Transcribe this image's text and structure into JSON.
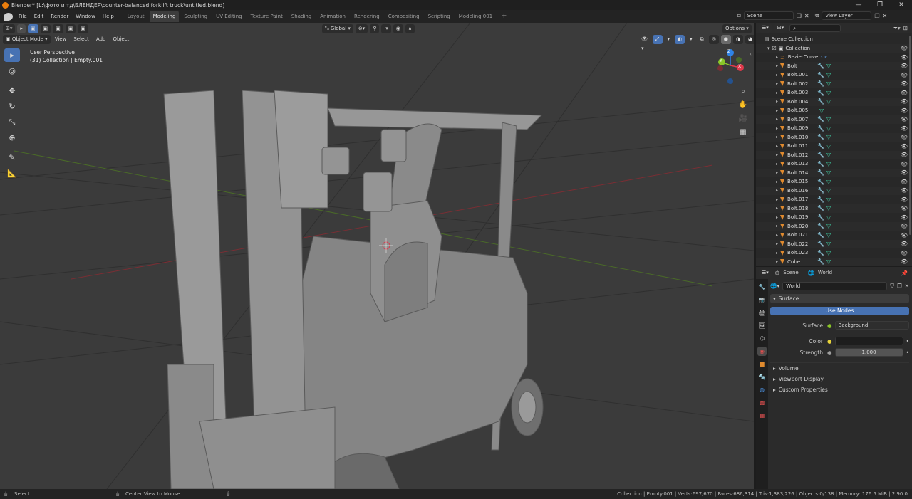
{
  "window": {
    "title": "Blender* [L:\\фото и тд\\БЛЕНДЕР\\counter-balanced forklift truck\\untitled.blend]",
    "controls": [
      "—",
      "❐",
      "✕"
    ]
  },
  "menu": [
    "File",
    "Edit",
    "Render",
    "Window",
    "Help"
  ],
  "workspaces": [
    "Layout",
    "Modeling",
    "Sculpting",
    "UV Editing",
    "Texture Paint",
    "Shading",
    "Animation",
    "Rendering",
    "Compositing",
    "Scripting",
    "Modeling.001"
  ],
  "active_workspace": "Modeling",
  "scene": {
    "name": "Scene",
    "view_layer": "View Layer"
  },
  "viewport": {
    "mode": "Object Mode",
    "menus": [
      "View",
      "Select",
      "Add",
      "Object"
    ],
    "transform_orientation": "Global",
    "options_label": "Options",
    "overlay_title": "User Perspective",
    "overlay_sub": "(31) Collection | Empty.001",
    "gizmo_axes": {
      "x": "X",
      "y": "Y",
      "z": "Z"
    },
    "colors": {
      "x": "#e0394b",
      "y": "#8ac628",
      "z": "#2f83e6"
    }
  },
  "outliner": {
    "search_placeholder": "",
    "root": "Scene Collection",
    "collection": "Collection",
    "items": [
      "BezierCurve",
      "Bolt",
      "Bolt.001",
      "Bolt.002",
      "Bolt.003",
      "Bolt.004",
      "Bolt.005",
      "Bolt.007",
      "Bolt.009",
      "Bolt.010",
      "Bolt.011",
      "Bolt.012",
      "Bolt.013",
      "Bolt.014",
      "Bolt.015",
      "Bolt.016",
      "Bolt.017",
      "Bolt.018",
      "Bolt.019",
      "Bolt.020",
      "Bolt.021",
      "Bolt.022",
      "Bolt.023",
      "Cube"
    ]
  },
  "properties": {
    "breadcrumb_scene": "Scene",
    "breadcrumb_world": "World",
    "world_name": "World",
    "surface_label": "Surface",
    "use_nodes": "Use Nodes",
    "surface_field_label": "Surface",
    "surface_value": "Background",
    "color_label": "Color",
    "strength_label": "Strength",
    "strength_value": "1.000",
    "panels": [
      "Volume",
      "Viewport Display",
      "Custom Properties"
    ]
  },
  "status": {
    "left": "Select",
    "middle": "Center View to Mouse",
    "right": "Collection | Empty.001 | Verts:697,670 | Faces:686,314 | Tris:1,383,226 | Objects:0/138 | Memory: 176.5 MiB | 2.90.0"
  }
}
